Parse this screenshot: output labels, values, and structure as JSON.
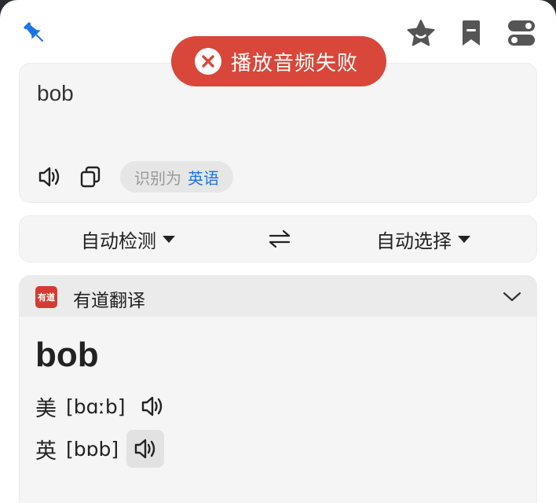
{
  "toolbar": {
    "pin_icon": "pin-icon",
    "favorite_icon": "star-icon",
    "bookmark_icon": "bookmark-icon",
    "settings_icon": "toggle-icon",
    "accent": "#1a73e8"
  },
  "toast": {
    "message": "播放音频失败",
    "color": "#d9473a"
  },
  "input": {
    "text": "bob",
    "detected_prefix": "识别为",
    "detected_language": "英语"
  },
  "languages": {
    "source": "自动检测",
    "target": "自动选择"
  },
  "result": {
    "provider": "有道翻译",
    "logo_text": "有道",
    "word": "bob",
    "phonetics": [
      {
        "label": "美",
        "text": "[bɑːb]"
      },
      {
        "label": "英",
        "text": "[bɒb]"
      }
    ]
  }
}
